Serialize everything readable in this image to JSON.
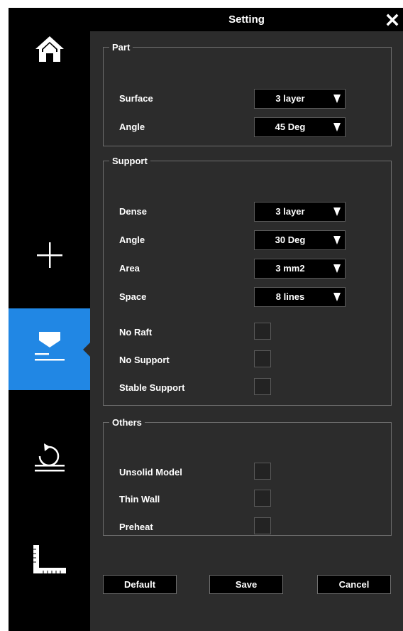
{
  "window": {
    "title": "Setting"
  },
  "sidebar": {
    "accent": "#2187e4",
    "items": [
      {
        "icon": "home-icon",
        "active": false
      },
      {
        "icon": "plus-icon",
        "active": false
      },
      {
        "icon": "support-icon",
        "active": true
      },
      {
        "icon": "rotate-icon",
        "active": false
      },
      {
        "icon": "ruler-icon",
        "active": false
      }
    ]
  },
  "part": {
    "legend": "Part",
    "surface_label": "Surface",
    "surface_value": "3 layer",
    "angle_label": "Angle",
    "angle_value": "45 Deg"
  },
  "support": {
    "legend": "Support",
    "dense_label": "Dense",
    "dense_value": "3 layer",
    "angle_label": "Angle",
    "angle_value": "30 Deg",
    "area_label": "Area",
    "area_value": "3 mm2",
    "space_label": "Space",
    "space_value": "8 lines",
    "no_raft_label": "No Raft",
    "no_raft_checked": false,
    "no_support_label": "No Support",
    "no_support_checked": false,
    "stable_support_label": "Stable Support",
    "stable_support_checked": false
  },
  "others": {
    "legend": "Others",
    "unsolid_model_label": "Unsolid Model",
    "unsolid_model_checked": false,
    "thin_wall_label": "Thin Wall",
    "thin_wall_checked": false,
    "preheat_label": "Preheat",
    "preheat_checked": false
  },
  "buttons": {
    "default": "Default",
    "save": "Save",
    "cancel": "Cancel"
  }
}
